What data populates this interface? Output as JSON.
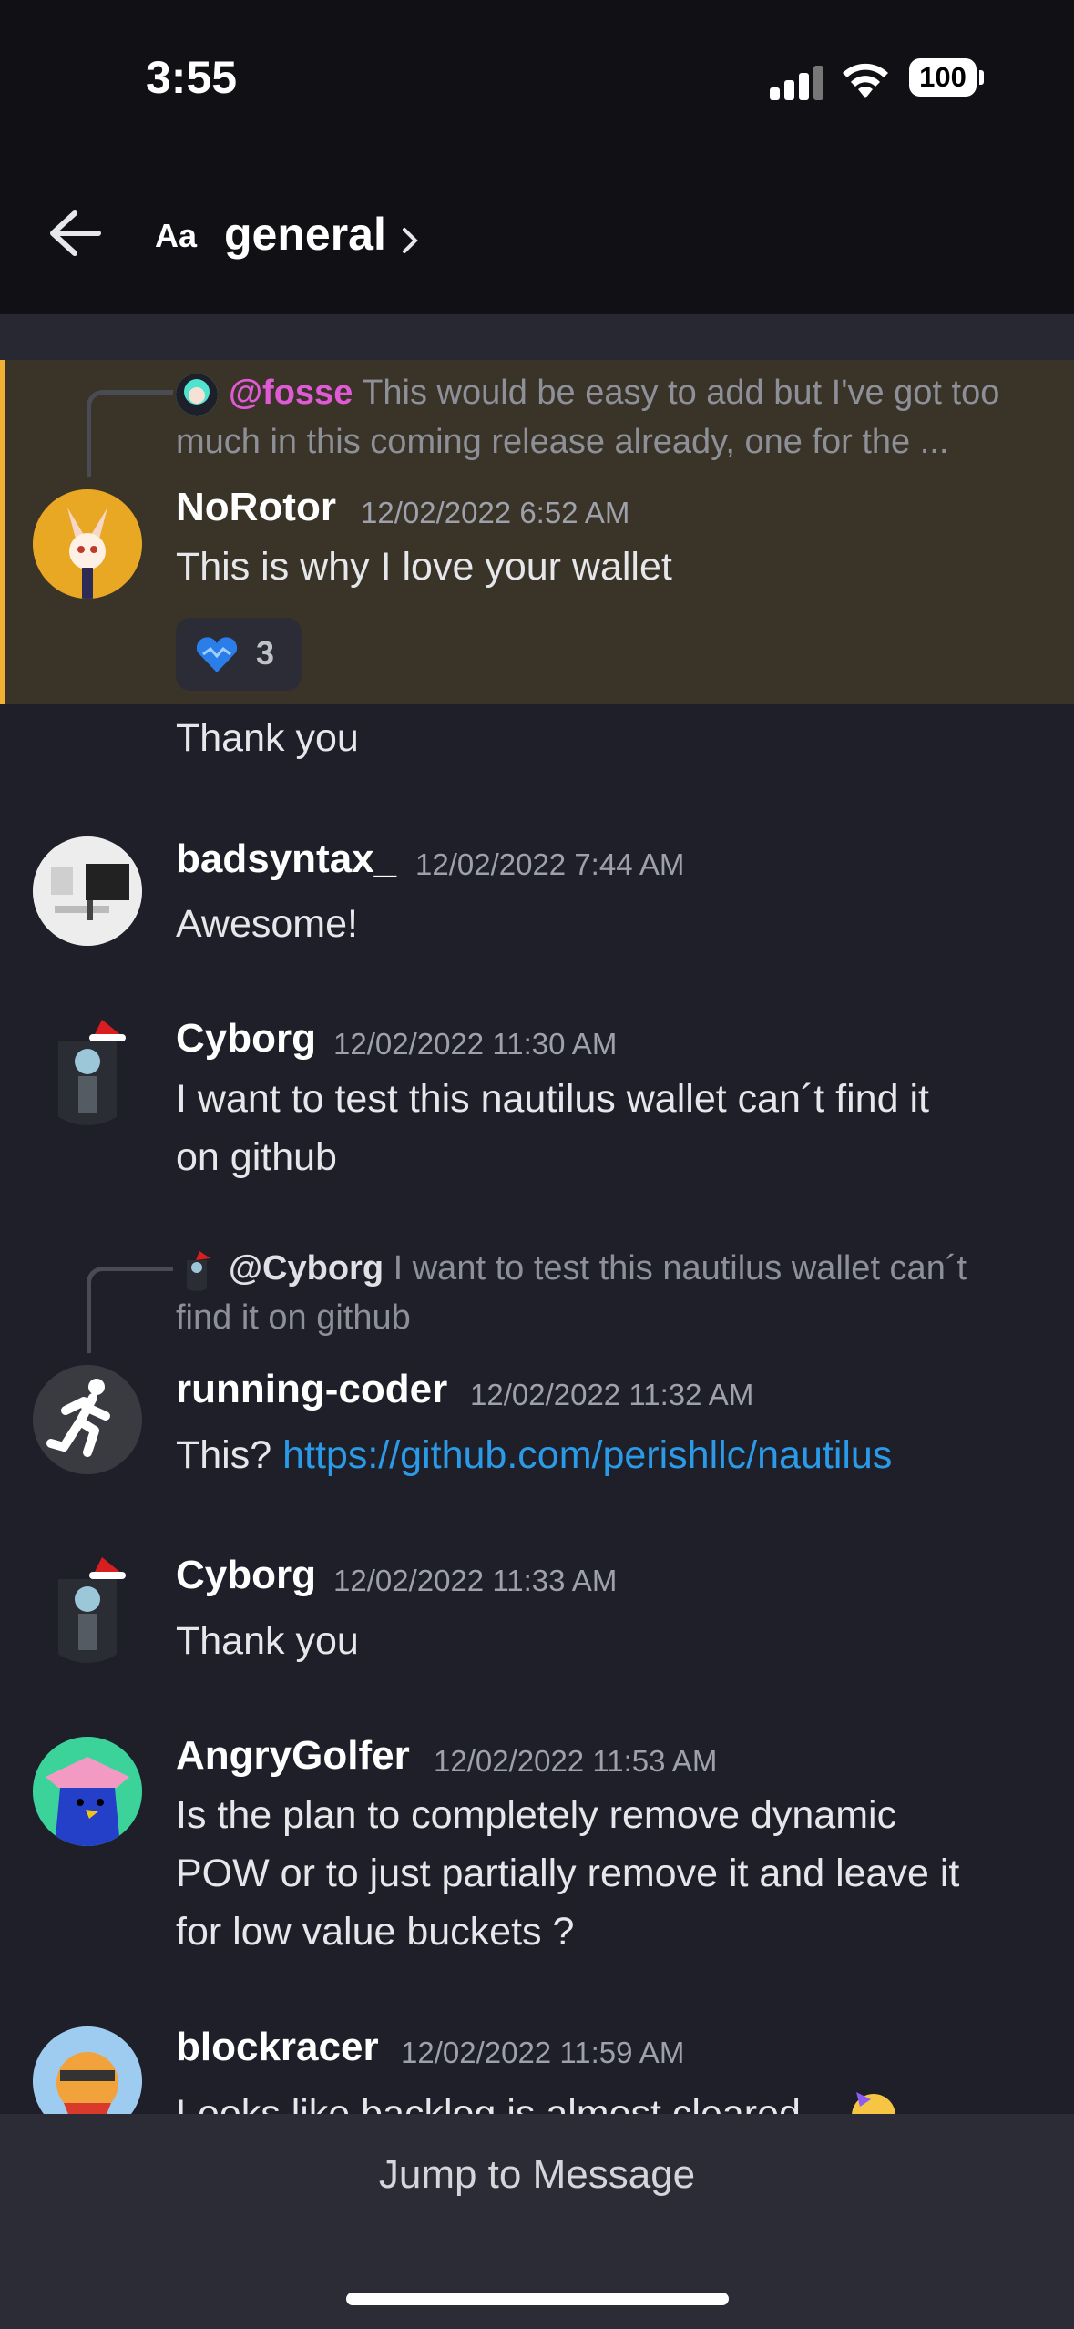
{
  "status_bar": {
    "time": "3:55",
    "battery": "100"
  },
  "header": {
    "aa_label": "Aa",
    "channel": "general"
  },
  "messages": [
    {
      "reply": {
        "mention": "@fosse",
        "text": "This would be easy to add but I've got too much in this coming release already, one for the ..."
      },
      "author": "NoRotor",
      "timestamp": "12/02/2022 6:52 AM",
      "text": "This is why I love your wallet",
      "reaction_count": "3",
      "followup": "Thank you"
    },
    {
      "author": "badsyntax_",
      "timestamp": "12/02/2022 7:44 AM",
      "text": "Awesome!"
    },
    {
      "author": "Cyborg",
      "timestamp": "12/02/2022 11:30 AM",
      "text_line1": "I want to test this nautilus wallet  can´t find it",
      "text_line2": "on github"
    },
    {
      "reply": {
        "mention": "@Cyborg",
        "text_line1": "I want to test this nautilus wallet  can´t",
        "text_line2": "find it on github"
      },
      "author": "running-coder",
      "timestamp": "12/02/2022 11:32 AM",
      "text_prefix": "This?",
      "link": "https://github.com/perishllc/nautilus"
    },
    {
      "author": "Cyborg",
      "timestamp": "12/02/2022 11:33 AM",
      "text": "Thank you"
    },
    {
      "author": "AngryGolfer",
      "timestamp": "12/02/2022 11:53 AM",
      "text_line1": "Is the plan to completely remove dynamic",
      "text_line2": "POW or to just partially remove it and leave it",
      "text_line3": "for low value buckets ?"
    },
    {
      "author": "blockracer",
      "timestamp": "12/02/2022 11:59 AM",
      "text": "Looks like backlog is almost cleared"
    }
  ],
  "bottom": {
    "jump_label": "Jump to Message"
  },
  "colors": {
    "highlight_bg": "#3a3428",
    "highlight_bar": "#f0b232",
    "link": "#2b9be8",
    "mention_pink": "#e05ad6"
  }
}
